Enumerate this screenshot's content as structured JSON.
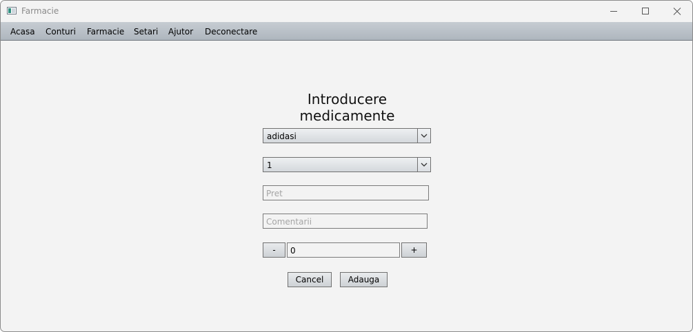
{
  "window": {
    "title": "Farmacie"
  },
  "menu": {
    "items": [
      "Acasa",
      "Conturi",
      "Farmacie",
      "Setari",
      "Ajutor",
      "Deconectare"
    ]
  },
  "form": {
    "title": "Introducere medicamente",
    "medicine_select": {
      "value": "adidasi"
    },
    "quantity_select": {
      "value": "1"
    },
    "price": {
      "placeholder": "Pret",
      "value": ""
    },
    "comments": {
      "placeholder": "Comentarii",
      "value": ""
    },
    "stepper": {
      "minus_label": "-",
      "value": "0",
      "plus_label": "+"
    },
    "cancel_label": "Cancel",
    "add_label": "Adauga"
  },
  "icons": {
    "app": "app-icon",
    "minimize": "minimize-icon",
    "maximize": "maximize-icon",
    "close": "close-icon",
    "dropdown": "chevron-down-icon"
  }
}
